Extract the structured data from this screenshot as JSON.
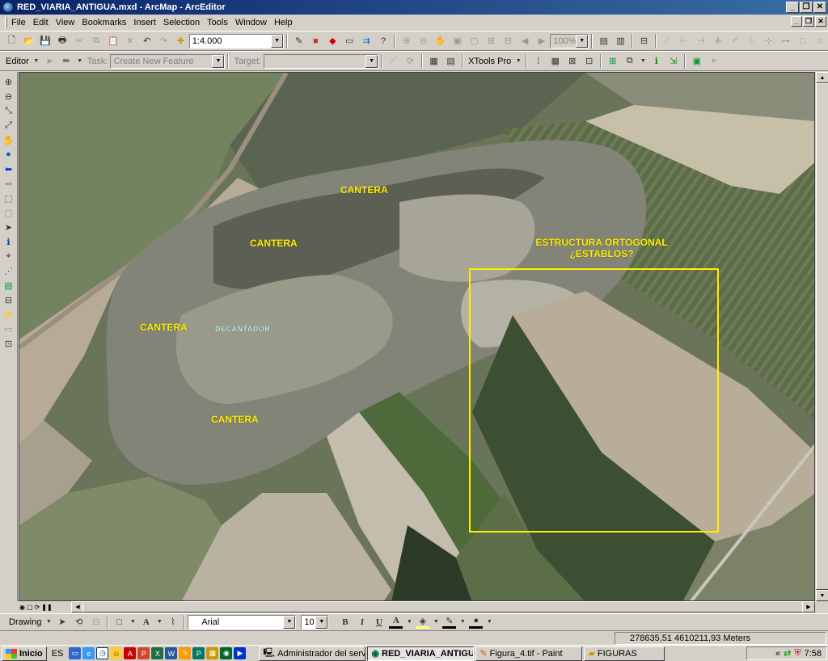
{
  "window": {
    "title": "RED_VIARIA_ANTIGUA.mxd - ArcMap - ArcEditor"
  },
  "menu": [
    "File",
    "Edit",
    "View",
    "Bookmarks",
    "Insert",
    "Selection",
    "Tools",
    "Window",
    "Help"
  ],
  "standard_toolbar": {
    "scale": "1:4.000",
    "zoom": "100%"
  },
  "editor_toolbar": {
    "editor_label": "Editor",
    "task_label": "Task:",
    "task_value": "Create New Feature",
    "target_label": "Target:",
    "target_value": "",
    "xtools_label": "XTools Pro"
  },
  "map": {
    "labels": {
      "cantera1": "CANTERA",
      "cantera2": "CANTERA",
      "cantera3": "CANTERA",
      "cantera4": "CANTERA",
      "decantador": "DECANTADOR",
      "estructura": "ESTRUCTURA ORTOGONAL",
      "establos": "¿ESTABLOS?"
    },
    "highlight_color": "#ffee00"
  },
  "drawing_toolbar": {
    "label": "Drawing",
    "font": "Arial",
    "size": "10"
  },
  "status": {
    "coordinates": "278635,51  4610211,93 Meters"
  },
  "taskbar": {
    "start": "Inicio",
    "lang": "ES",
    "tasks": [
      "Administrador del servidor",
      "RED_VIARIA_ANTIGU...",
      "Figura_4.tif - Paint",
      "FIGURAS"
    ],
    "clock": "7:58"
  }
}
